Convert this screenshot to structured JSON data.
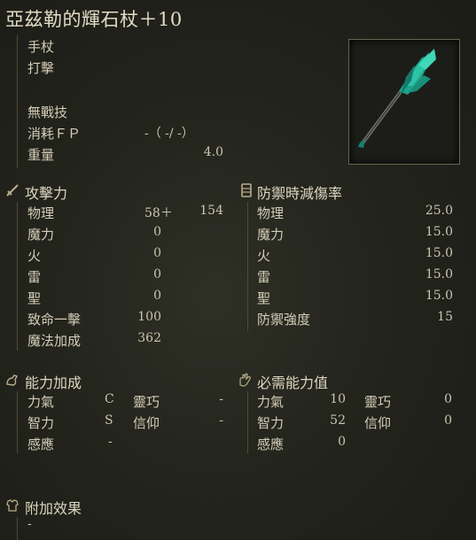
{
  "title": "亞茲勒的輝石杖＋10",
  "weapon_type": "手杖",
  "attack_type": "打擊",
  "skill": "無戰技",
  "fp_label": "消耗ＦＰ",
  "fp_value": "-（ -/ -）",
  "weight_label": "重量",
  "weight_value": "4.0",
  "attack": {
    "header": "攻擊力",
    "rows": [
      {
        "label": "物理",
        "value": "58＋",
        "extra": "154"
      },
      {
        "label": "魔力",
        "value": "0"
      },
      {
        "label": "火",
        "value": "0"
      },
      {
        "label": "雷",
        "value": "0"
      },
      {
        "label": "聖",
        "value": "0"
      },
      {
        "label": "致命一擊",
        "value": "100"
      },
      {
        "label": "魔法加成",
        "value": "362"
      }
    ]
  },
  "guard": {
    "header": "防禦時減傷率",
    "rows": [
      {
        "label": "物理",
        "value": "25.0"
      },
      {
        "label": "魔力",
        "value": "15.0"
      },
      {
        "label": "火",
        "value": "15.0"
      },
      {
        "label": "雷",
        "value": "15.0"
      },
      {
        "label": "聖",
        "value": "15.0"
      },
      {
        "label": "防禦強度",
        "value": "15"
      }
    ]
  },
  "scaling": {
    "header": "能力加成",
    "rows": [
      {
        "l1": "力氣",
        "v1": "C",
        "l2": "靈巧",
        "v2": "-"
      },
      {
        "l1": "智力",
        "v1": "S",
        "l2": "信仰",
        "v2": "-"
      },
      {
        "l1": "感應",
        "v1": "-"
      }
    ]
  },
  "requirements": {
    "header": "必需能力值",
    "rows": [
      {
        "l1": "力氣",
        "v1": "10",
        "l2": "靈巧",
        "v2": "0"
      },
      {
        "l1": "智力",
        "v1": "52",
        "l2": "信仰",
        "v2": "0"
      },
      {
        "l1": "感應",
        "v1": "0"
      }
    ]
  },
  "effects": {
    "header": "附加效果",
    "value": "-"
  },
  "colors": {
    "background": "#23241c",
    "text": "#d9d3bf",
    "staff_crystal": "#1fa38a"
  }
}
